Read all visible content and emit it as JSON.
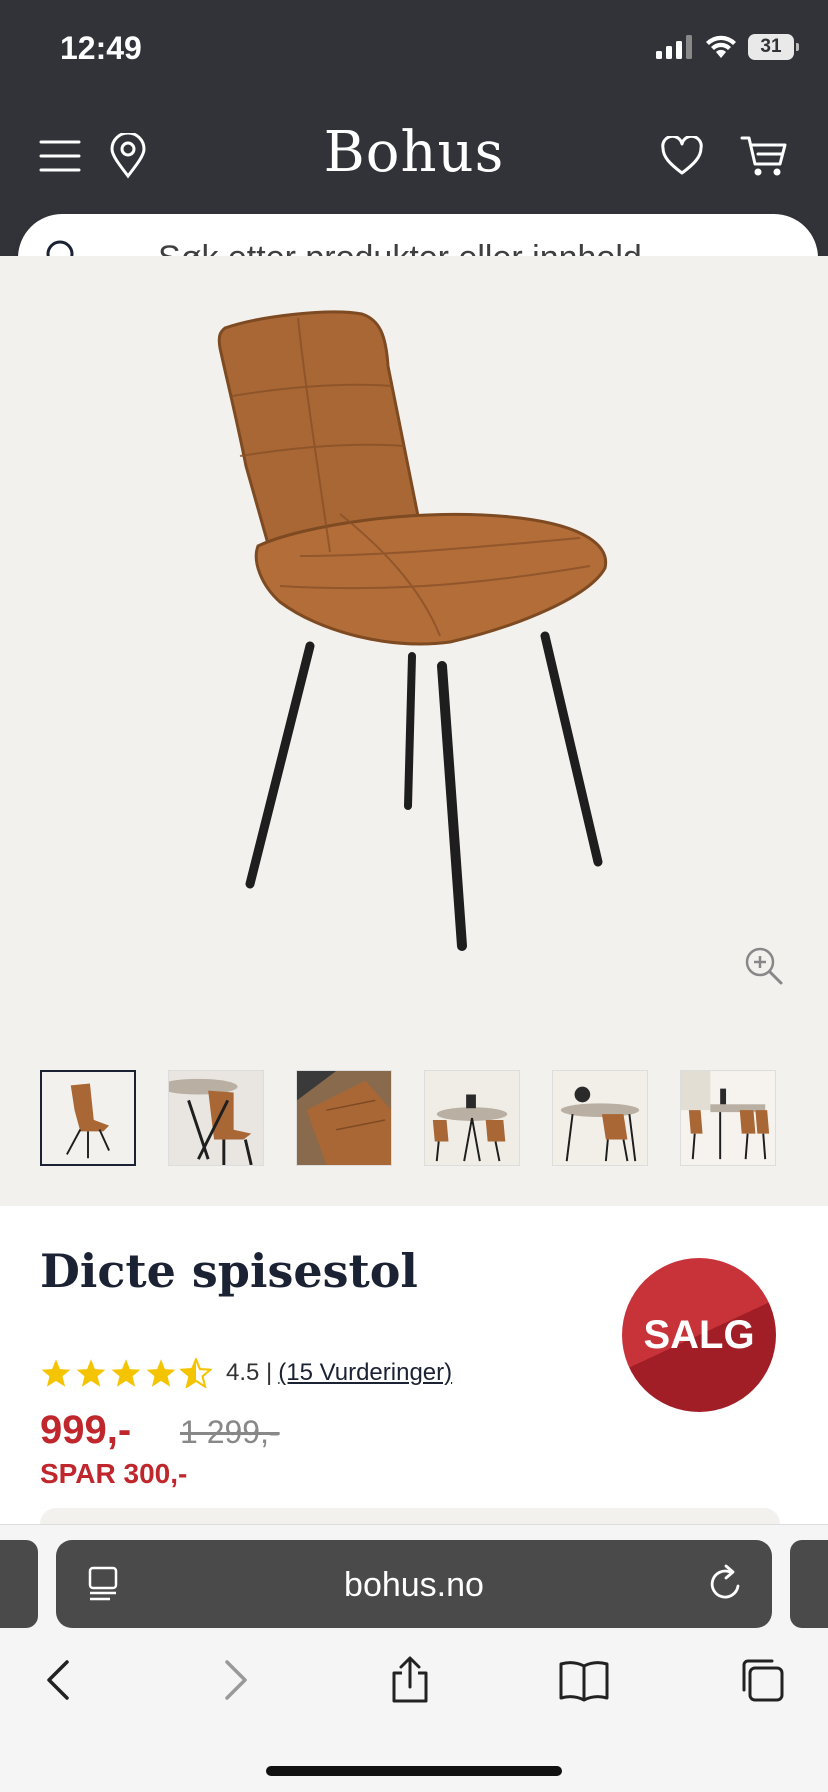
{
  "status_bar": {
    "time": "12:49",
    "battery": "31"
  },
  "header": {
    "logo": "Bohus"
  },
  "search": {
    "placeholder": "Søk etter produkter eller innhold..."
  },
  "product": {
    "title": "Dicte spisestol",
    "badge": "SALG",
    "rating": 4.5,
    "rating_text": "4.5 |",
    "reviews_link": "(15 Vurderinger)",
    "price": "999,-",
    "old_price": "1 299,-",
    "save": "SPAR 300,-",
    "thumbnail_count": 6
  },
  "browser": {
    "url": "bohus.no"
  },
  "colors": {
    "header_bg": "#323339",
    "sale_red": "#c0272d",
    "star_yellow": "#f5c400",
    "text_navy": "#1b2233"
  },
  "icons": [
    "menu-icon",
    "location-pin-icon",
    "heart-icon",
    "cart-icon",
    "search-icon",
    "zoom-in-icon",
    "reader-icon",
    "reload-icon",
    "back-icon",
    "forward-icon",
    "share-icon",
    "bookmarks-icon",
    "tabs-icon"
  ]
}
